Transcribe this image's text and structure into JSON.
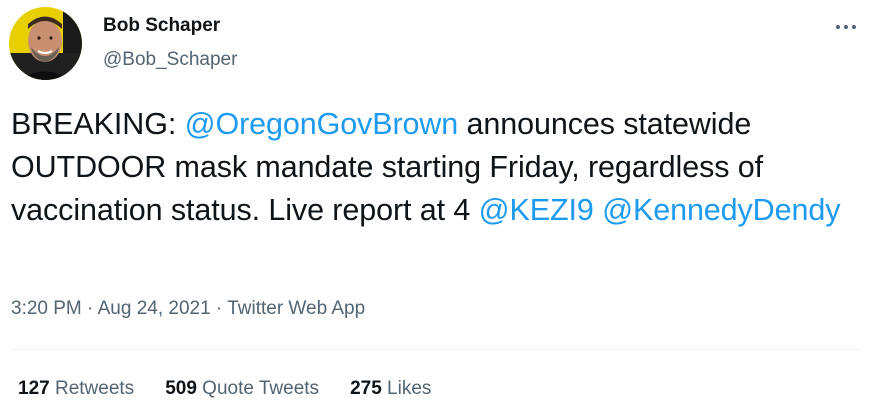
{
  "author": {
    "display_name": "Bob Schaper",
    "handle": "@Bob_Schaper"
  },
  "tweet": {
    "text_prefix": "BREAKING: ",
    "mention_1": "@OregonGovBrown",
    "text_middle": " announces statewide OUTDOOR mask mandate starting Friday, regardless of vaccination status. Live report at 4 ",
    "mention_2": "@KEZI9",
    "mention_3": "@KennedyDendy"
  },
  "meta": {
    "time": "3:20 PM",
    "separator": " · ",
    "date": "Aug 24, 2021",
    "source": "Twitter Web App"
  },
  "stats": {
    "retweets_count": "127",
    "retweets_label": "Retweets",
    "quotes_count": "509",
    "quotes_label": "Quote Tweets",
    "likes_count": "275",
    "likes_label": "Likes"
  },
  "colors": {
    "link": "#1d9bf0",
    "secondary_text": "#536471",
    "primary_text": "#0f1419",
    "avatar_ring": "#e8d000"
  },
  "icons": {
    "more": "more-dots-icon"
  }
}
